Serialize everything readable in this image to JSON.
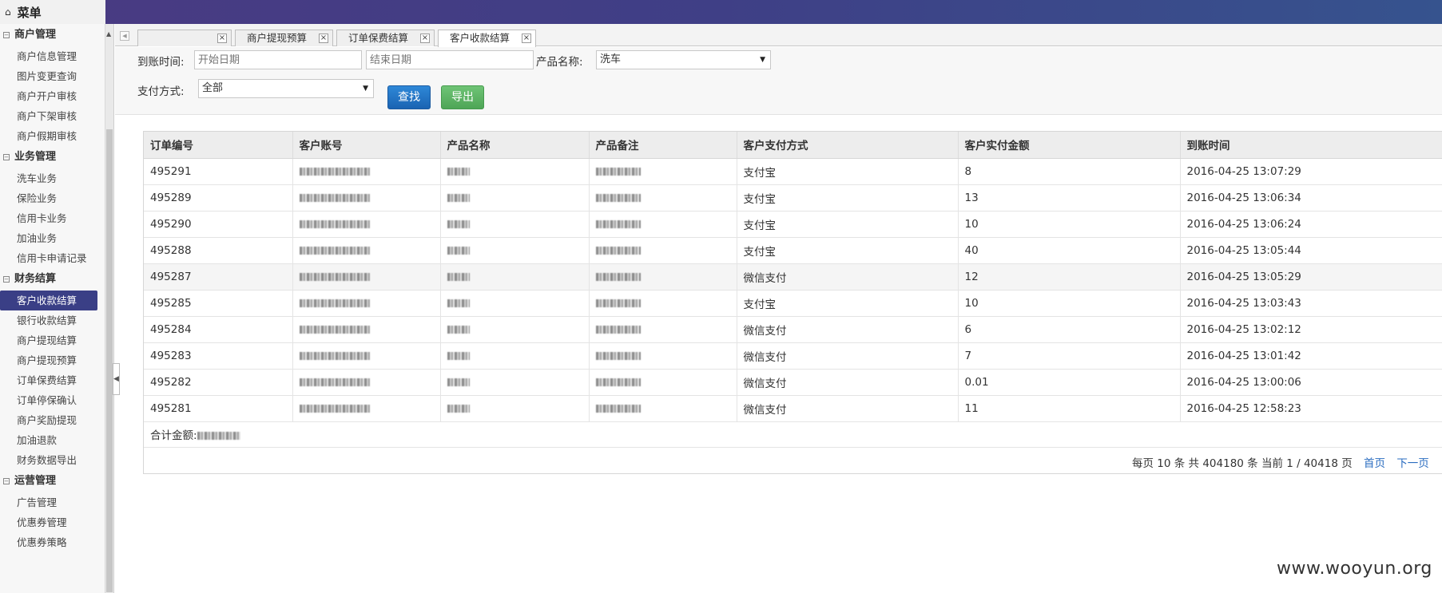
{
  "header": {
    "home_icon": "home-icon",
    "menu_title": "菜单"
  },
  "sidebar": {
    "groups": [
      {
        "title": "商户管理",
        "items": [
          "商户信息管理",
          "图片变更查询",
          "商户开户审核",
          "商户下架审核",
          "商户假期审核"
        ]
      },
      {
        "title": "业务管理",
        "items": [
          "洗车业务",
          "保险业务",
          "信用卡业务",
          "加油业务",
          "信用卡申请记录"
        ]
      },
      {
        "title": "财务结算",
        "items": [
          "客户收款结算",
          "银行收款结算",
          "商户提现结算",
          "商户提现预算",
          "订单保费结算",
          "订单停保确认",
          "商户奖励提现",
          "加油退款",
          "财务数据导出"
        ]
      },
      {
        "title": "运营管理",
        "items": [
          "广告管理",
          "优惠券管理",
          "优惠券策略"
        ]
      }
    ],
    "active_item": "客户收款结算"
  },
  "tabs": [
    {
      "label": "",
      "active": false
    },
    {
      "label": "商户提现预算",
      "active": false
    },
    {
      "label": "订单保费结算",
      "active": false
    },
    {
      "label": "客户收款结算",
      "active": true
    }
  ],
  "filter": {
    "date_label": "到账时间:",
    "start_placeholder": "开始日期",
    "end_placeholder": "结束日期",
    "product_label": "产品名称:",
    "product_value": "洗车",
    "pay_label": "支付方式:",
    "pay_value": "全部",
    "search_button": "查找",
    "export_button": "导出"
  },
  "table": {
    "columns": [
      "订单编号",
      "客户账号",
      "产品名称",
      "产品备注",
      "客户支付方式",
      "客户实付金额",
      "到账时间"
    ],
    "rows": [
      {
        "id": "495291",
        "pay": "支付宝",
        "amount": "8",
        "time": "2016-04-25 13:07:29"
      },
      {
        "id": "495289",
        "pay": "支付宝",
        "amount": "13",
        "time": "2016-04-25 13:06:34"
      },
      {
        "id": "495290",
        "pay": "支付宝",
        "amount": "10",
        "time": "2016-04-25 13:06:24"
      },
      {
        "id": "495288",
        "pay": "支付宝",
        "amount": "40",
        "time": "2016-04-25 13:05:44"
      },
      {
        "id": "495287",
        "pay": "微信支付",
        "amount": "12",
        "time": "2016-04-25 13:05:29"
      },
      {
        "id": "495285",
        "pay": "支付宝",
        "amount": "10",
        "time": "2016-04-25 13:03:43"
      },
      {
        "id": "495284",
        "pay": "微信支付",
        "amount": "6",
        "time": "2016-04-25 13:02:12"
      },
      {
        "id": "495283",
        "pay": "微信支付",
        "amount": "7",
        "time": "2016-04-25 13:01:42"
      },
      {
        "id": "495282",
        "pay": "微信支付",
        "amount": "0.01",
        "time": "2016-04-25 13:00:06"
      },
      {
        "id": "495281",
        "pay": "微信支付",
        "amount": "11",
        "time": "2016-04-25 12:58:23"
      }
    ],
    "total_label": "合计金额:"
  },
  "pager": {
    "summary": "每页 10 条  共 404180 条  当前 1 / 40418 页",
    "first": "首页",
    "next": "下一页"
  },
  "watermark": "www.wooyun.org",
  "colors": {
    "banner": "#3f3f86",
    "active_item": "#3a3f86",
    "search_btn": "#1a63b2",
    "export_btn": "#4ea556"
  }
}
